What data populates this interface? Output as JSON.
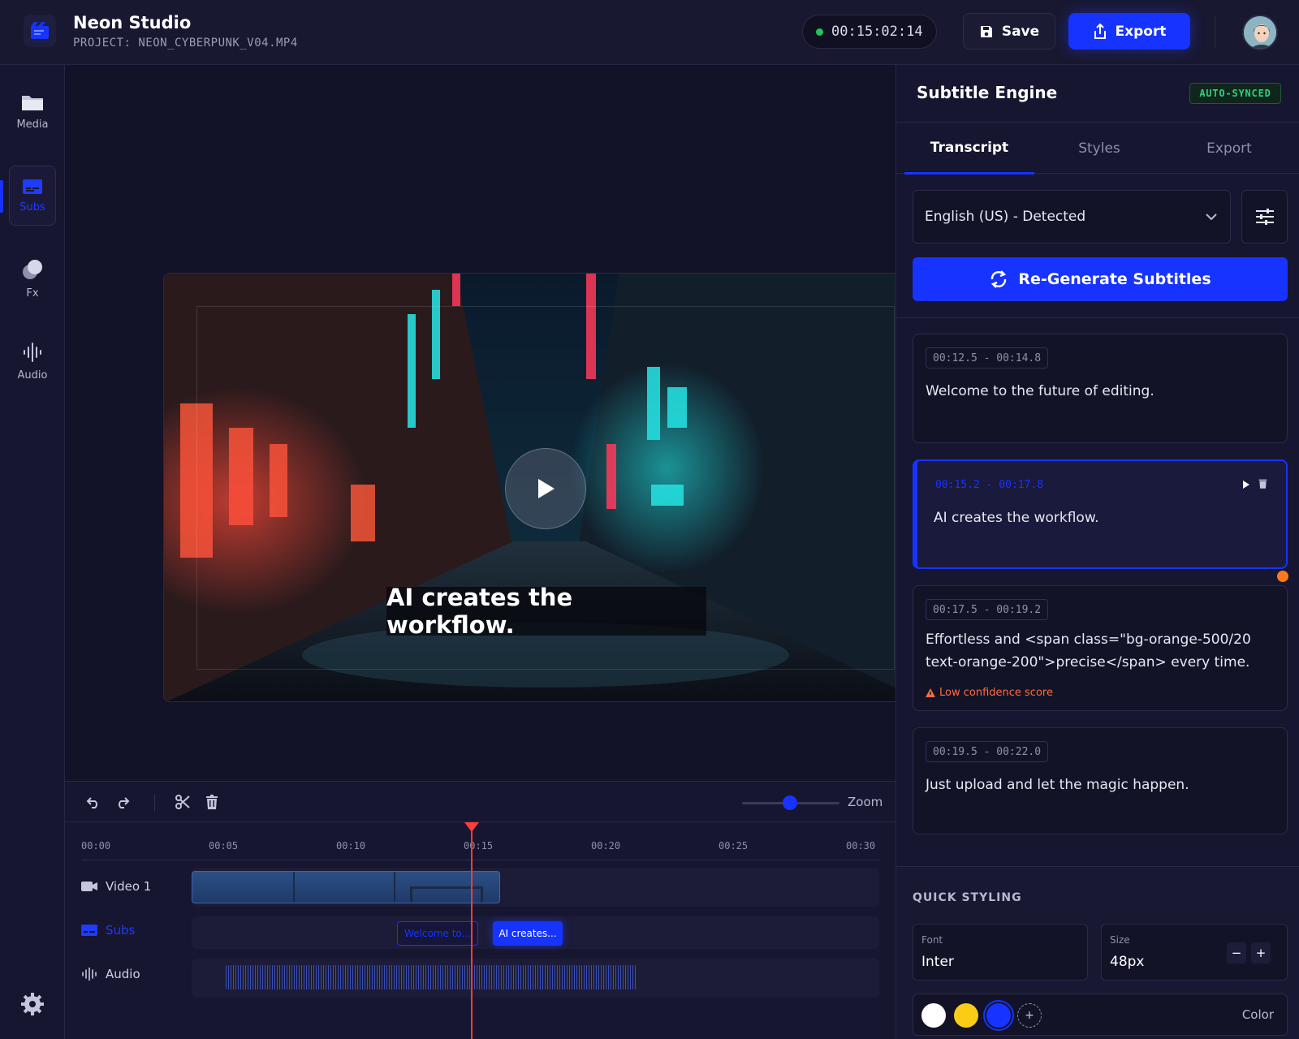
{
  "header": {
    "app_title": "Neon Studio",
    "project": "PROJECT: NEON_CYBERPUNK_V04.MP4",
    "timecode": "00:15:02:14",
    "save_label": "Save",
    "export_label": "Export"
  },
  "sidebar": {
    "items": [
      {
        "label": "Media",
        "icon": "folder-icon"
      },
      {
        "label": "Subs",
        "icon": "subtitles-icon",
        "active": true
      },
      {
        "label": "Fx",
        "icon": "effects-icon"
      },
      {
        "label": "Audio",
        "icon": "audio-wave-icon"
      }
    ]
  },
  "preview": {
    "caption": "AI creates the workflow."
  },
  "timeline": {
    "zoom_label": "Zoom",
    "ruler": [
      "00:00",
      "00:05",
      "00:10",
      "00:15",
      "00:20",
      "00:25",
      "00:30"
    ],
    "tracks": [
      {
        "label": "Video 1"
      },
      {
        "label": "Subs"
      },
      {
        "label": "Audio"
      }
    ],
    "clips": {
      "sub1": "Welcome to...",
      "sub2": "AI creates..."
    }
  },
  "panel": {
    "title": "Subtitle Engine",
    "badge": "AUTO-SYNCED",
    "tabs": [
      "Transcript",
      "Styles",
      "Export"
    ],
    "language": "English (US) - Detected",
    "regenerate_label": "Re-Generate Subtitles",
    "cards": [
      {
        "time": "00:12.5 - 00:14.8",
        "text": "Welcome to the future of editing."
      },
      {
        "time": "00:15.2 - 00:17.8",
        "text": "AI creates the workflow."
      },
      {
        "time": "00:17.5 - 00:19.2",
        "text": "Effortless and <span class=\"bg-orange-500/20 text-orange-200\">precise</span> every time.",
        "warning": "Low confidence score"
      },
      {
        "time": "00:19.5 - 00:22.0",
        "text": "Just upload and let the magic happen."
      }
    ],
    "quick_styling": {
      "title": "QUICK STYLING",
      "font_label": "Font",
      "font_value": "Inter",
      "size_label": "Size",
      "size_value": "48px",
      "minus": "−",
      "plus": "+",
      "color_label": "Color",
      "swatches": [
        "#ffffff",
        "#facc15",
        "#1733ff"
      ]
    }
  },
  "colors": {
    "accent": "#1733ff",
    "success": "#22c55e",
    "warning": "#ff6b3d",
    "playhead": "#ff3b3b"
  }
}
